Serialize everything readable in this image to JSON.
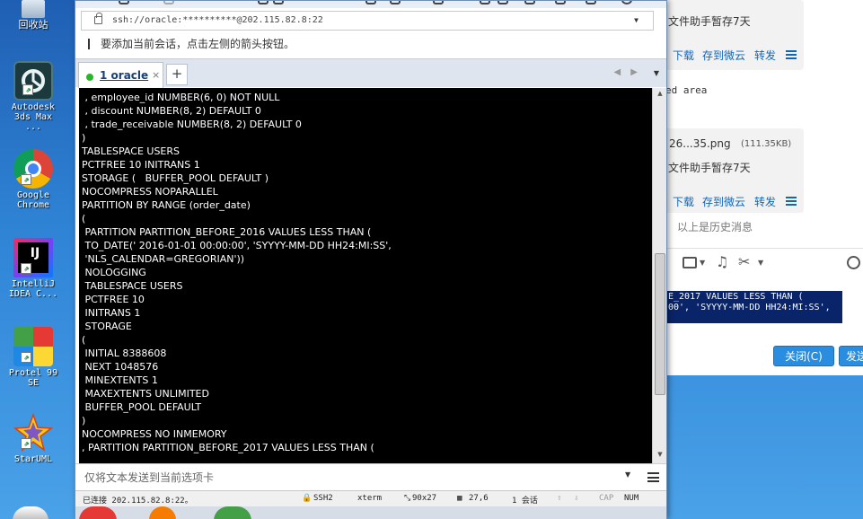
{
  "desktop": {
    "icons": [
      {
        "label": "回收站",
        "icon": "recycle-bin-icon"
      },
      {
        "label": "Autodesk 3ds Max ...",
        "icon": "3ds-max-icon"
      },
      {
        "label": "Google Chrome",
        "icon": "chrome-icon"
      },
      {
        "label": "IntelliJ IDEA C...",
        "icon": "intellij-icon"
      },
      {
        "label": "Protel 99 SE",
        "icon": "protel-icon"
      },
      {
        "label": "StarUML",
        "icon": "staruml-icon"
      }
    ]
  },
  "terminal_window": {
    "address": "ssh://oracle:**********@202.115.82.8:22",
    "hint": "要添加当前会话，点击左侧的箭头按钮。",
    "tab": {
      "label": "1 oracle",
      "close": "×",
      "add": "+"
    },
    "tab_nav": "◀ ▶",
    "lines": [
      " , employee_id NUMBER(6, 0) NOT NULL",
      " , discount NUMBER(8, 2) DEFAULT 0",
      " , trade_receivable NUMBER(8, 2) DEFAULT 0",
      ")",
      "TABLESPACE USERS",
      "PCTFREE 10 INITRANS 1",
      "STORAGE (   BUFFER_POOL DEFAULT )",
      "NOCOMPRESS NOPARALLEL",
      "PARTITION BY RANGE (order_date)",
      "(",
      " PARTITION PARTITION_BEFORE_2016 VALUES LESS THAN (",
      " TO_DATE(' 2016-01-01 00:00:00', 'SYYYY-MM-DD HH24:MI:SS',",
      " 'NLS_CALENDAR=GREGORIAN'))",
      " NOLOGGING",
      " TABLESPACE USERS",
      " PCTFREE 10",
      " INITRANS 1",
      " STORAGE",
      "(",
      " INITIAL 8388608",
      " NEXT 1048576",
      " MINEXTENTS 1",
      " MAXEXTENTS UNLIMITED",
      " BUFFER_POOL DEFAULT",
      ")",
      "NOCOMPRESS NO INMEMORY",
      ", PARTITION PARTITION_BEFORE_2017 VALUES LESS THAN ("
    ],
    "send_placeholder": "仅将文本发送到当前选项卡",
    "status": {
      "connection": "已连接 202.115.82.8:22。",
      "protocol": "SSH2",
      "terminal": "xterm",
      "size": "90x27",
      "cursor": "27,6",
      "sessions": "1 会话",
      "caps": "CAP",
      "num": "NUM"
    }
  },
  "chat_window": {
    "line1": "文件助手暂存7天",
    "actions": {
      "download": "下载",
      "save_cloud": "存到微云",
      "forward": "转发"
    },
    "text_fragment": "ed area",
    "file_name": "26...35.png",
    "file_size": "(111.35KB)",
    "line2": "文件助手暂存7天",
    "history": "以上是历史消息",
    "selected_text": "E_2017 VALUES LESS THAN (\n00', 'SYYYY-MM-DD HH24:MI:SS',\n",
    "close_button": "关闭(C)",
    "send_button": "发送"
  }
}
